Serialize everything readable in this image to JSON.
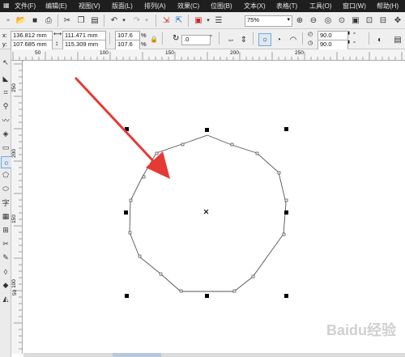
{
  "menu": {
    "items": [
      "文件(F)",
      "编辑(E)",
      "视图(V)",
      "版面(L)",
      "排列(A)",
      "效果(C)",
      "位图(B)",
      "文本(X)",
      "表格(T)",
      "工具(O)",
      "窗口(W)",
      "帮助(H)"
    ]
  },
  "toolbar": {
    "zoom_value": "75%",
    "icons": [
      "new-icon",
      "open-icon",
      "save-icon",
      "print-icon",
      "cut-icon",
      "copy-icon",
      "paste-icon",
      "undo-icon",
      "redo-icon",
      "import-icon",
      "export-icon",
      "zoom-in-icon",
      "zoom-out-icon"
    ]
  },
  "property_bar": {
    "x_label": "x:",
    "x_value": "136.812 mm",
    "y_label": "y:",
    "y_value": "107.685 mm",
    "width_value": "111.471 mm",
    "height_value": "115.309 mm",
    "scale_x": "107.6",
    "scale_y": "107.6",
    "percent": "%",
    "rotation_value": ".0",
    "degree": "°",
    "angle_start": "90.0",
    "angle_end": "90.0"
  },
  "ruler_top_labels": [
    "50",
    "100",
    "150",
    "200",
    "250"
  ],
  "ruler_left_labels": [
    "250",
    "200",
    "150",
    "100",
    "50"
  ],
  "watermark": "Baidu经验",
  "colors": {
    "menubar_bg": "#1e1e1e",
    "arrow": "#e53935",
    "shape_stroke": "#555555"
  }
}
